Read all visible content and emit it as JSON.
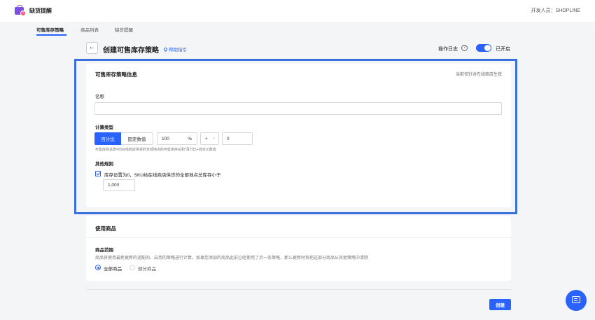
{
  "app": {
    "title": "缺货提醒",
    "developer": "开发人员：SHOPLINE",
    "logo_icon": "shopping-bag-icon"
  },
  "tabs": [
    {
      "label": "可售库存策略",
      "active": true
    },
    {
      "label": "商品列表",
      "active": false
    },
    {
      "label": "缺货提醒",
      "active": false
    }
  ],
  "page": {
    "back_icon": "←",
    "title": "创建可售库存策略",
    "help_label": "帮助指引",
    "oplog_label": "操作日志",
    "qmark": "?",
    "toggle_label": "已开启",
    "toggle_on": true
  },
  "strategy_card": {
    "title": "可售库存策略信息",
    "note": "当前仅针对在线商店生效",
    "name_label": "名称",
    "name_value": "",
    "calc_label": "计算类型",
    "seg_active": "百分比",
    "seg_inactive": "固定数值",
    "percent_value": "100",
    "percent_unit": "%",
    "operator": "+",
    "operator_caret": "⌄",
    "offset_value": "0",
    "calc_hint": "可售库存总数=向在线商店供货的全部地点的可售库存总和*百分比+自定义数值",
    "other_rules_label": "其他规则",
    "rule_text": "库存设置为0，SKU给在线商店供货的全部地点总库存小于",
    "rule_checked": true,
    "threshold_value": "1,000"
  },
  "products_card": {
    "title": "使用商品",
    "scope_label": "商品范围",
    "scope_hint": "商品将使用最新更新的适配的。启用的策略进行计算。如果您添加的商品此前已经使用了另一条策略，那么更新时将把这部分商品从其他策略中清除",
    "options": [
      {
        "label": "全部商品",
        "checked": true
      },
      {
        "label": "部分商品",
        "checked": false
      }
    ]
  },
  "footer": {
    "create_label": "创建"
  },
  "colors": {
    "accent": "#2962ff",
    "highlight": "#3b6fe0",
    "brand": "#7b4fe0"
  }
}
